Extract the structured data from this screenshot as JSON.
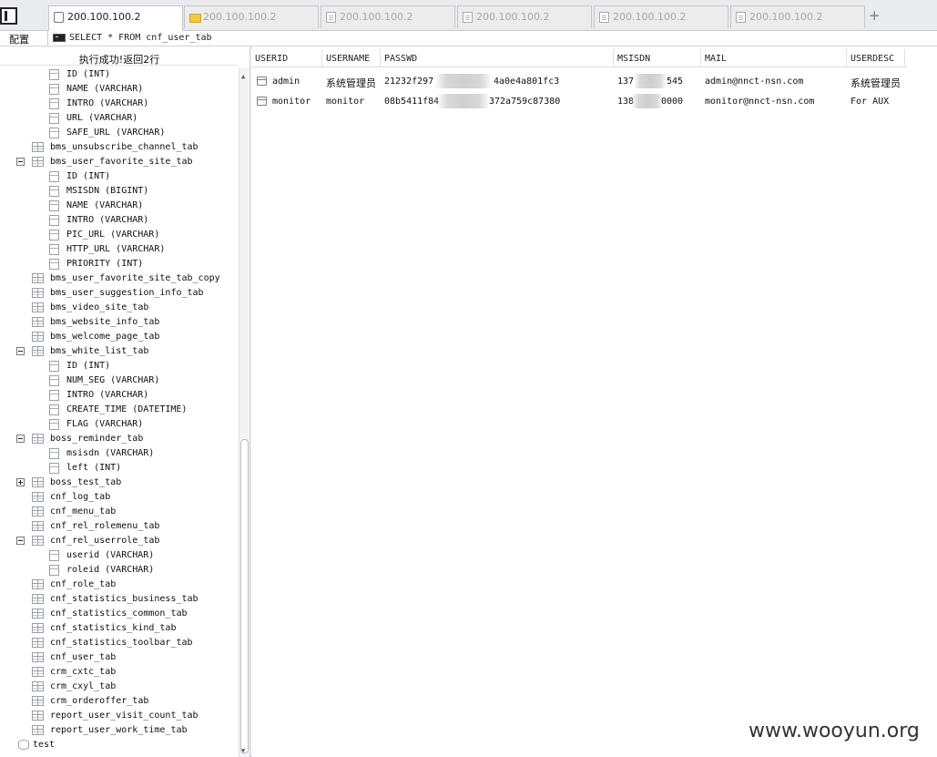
{
  "tabs": [
    {
      "label": "200.100.100.2",
      "icon": "blank-page-icon",
      "active": true
    },
    {
      "label": "200.100.100.2",
      "icon": "folder-icon",
      "active": false
    },
    {
      "label": "200.100.100.2",
      "icon": "document-icon",
      "active": false
    },
    {
      "label": "200.100.100.2",
      "icon": "document-icon",
      "active": false
    },
    {
      "label": "200.100.100.2",
      "icon": "document-icon",
      "active": false
    },
    {
      "label": "200.100.100.2",
      "icon": "document-icon",
      "active": false
    }
  ],
  "new_tab_symbol": "+",
  "toolbar": {
    "config_label": "配置",
    "query": "SELECT * FROM cnf_user_tab"
  },
  "left_panel": {
    "status": "执行成功!返回2行",
    "tree": [
      {
        "label": "ID (INT)",
        "kind": "column"
      },
      {
        "label": "NAME (VARCHAR)",
        "kind": "column"
      },
      {
        "label": "INTRO (VARCHAR)",
        "kind": "column"
      },
      {
        "label": "URL (VARCHAR)",
        "kind": "column"
      },
      {
        "label": "SAFE_URL (VARCHAR)",
        "kind": "column"
      },
      {
        "label": "bms_unsubscribe_channel_tab",
        "kind": "table"
      },
      {
        "label": "bms_user_favorite_site_tab",
        "kind": "table",
        "expand": "minus"
      },
      {
        "label": "ID (INT)",
        "kind": "column"
      },
      {
        "label": "MSISDN (BIGINT)",
        "kind": "column"
      },
      {
        "label": "NAME (VARCHAR)",
        "kind": "column"
      },
      {
        "label": "INTRO (VARCHAR)",
        "kind": "column"
      },
      {
        "label": "PIC_URL (VARCHAR)",
        "kind": "column"
      },
      {
        "label": "HTTP_URL (VARCHAR)",
        "kind": "column"
      },
      {
        "label": "PRIORITY (INT)",
        "kind": "column"
      },
      {
        "label": "bms_user_favorite_site_tab_copy",
        "kind": "table"
      },
      {
        "label": "bms_user_suggestion_info_tab",
        "kind": "table"
      },
      {
        "label": "bms_video_site_tab",
        "kind": "table"
      },
      {
        "label": "bms_website_info_tab",
        "kind": "table"
      },
      {
        "label": "bms_welcome_page_tab",
        "kind": "table"
      },
      {
        "label": "bms_white_list_tab",
        "kind": "table",
        "expand": "minus"
      },
      {
        "label": "ID (INT)",
        "kind": "column"
      },
      {
        "label": "NUM_SEG (VARCHAR)",
        "kind": "column"
      },
      {
        "label": "INTRO (VARCHAR)",
        "kind": "column"
      },
      {
        "label": "CREATE_TIME (DATETIME)",
        "kind": "column"
      },
      {
        "label": "FLAG (VARCHAR)",
        "kind": "column"
      },
      {
        "label": "boss_reminder_tab",
        "kind": "table",
        "expand": "minus"
      },
      {
        "label": "msisdn (VARCHAR)",
        "kind": "column"
      },
      {
        "label": "left (INT)",
        "kind": "column"
      },
      {
        "label": "boss_test_tab",
        "kind": "table",
        "expand": "plus"
      },
      {
        "label": "cnf_log_tab",
        "kind": "table"
      },
      {
        "label": "cnf_menu_tab",
        "kind": "table"
      },
      {
        "label": "cnf_rel_rolemenu_tab",
        "kind": "table"
      },
      {
        "label": "cnf_rel_userrole_tab",
        "kind": "table",
        "expand": "minus"
      },
      {
        "label": "userid (VARCHAR)",
        "kind": "column"
      },
      {
        "label": "roleid (VARCHAR)",
        "kind": "column"
      },
      {
        "label": "cnf_role_tab",
        "kind": "table"
      },
      {
        "label": "cnf_statistics_business_tab",
        "kind": "table"
      },
      {
        "label": "cnf_statistics_common_tab",
        "kind": "table"
      },
      {
        "label": "cnf_statistics_kind_tab",
        "kind": "table"
      },
      {
        "label": "cnf_statistics_toolbar_tab",
        "kind": "table"
      },
      {
        "label": "cnf_user_tab",
        "kind": "table"
      },
      {
        "label": "crm_cxtc_tab",
        "kind": "table"
      },
      {
        "label": "crm_cxyl_tab",
        "kind": "table"
      },
      {
        "label": "crm_orderoffer_tab",
        "kind": "table"
      },
      {
        "label": "report_user_visit_count_tab",
        "kind": "table"
      },
      {
        "label": "report_user_work_time_tab",
        "kind": "table"
      },
      {
        "label": "test",
        "kind": "database"
      }
    ]
  },
  "result": {
    "columns": [
      "USERID",
      "USERNAME",
      "PASSWD",
      "MSISDN",
      "MAIL",
      "USERDESC"
    ],
    "rows": [
      {
        "userid": "admin",
        "username": "系统管理员",
        "passwd_start": "21232f297",
        "passwd_end": "4a0e4a801fc3",
        "msisdn_start": "137",
        "msisdn_end": "545",
        "mail": "admin@nnct-nsn.com",
        "userdesc": "系统管理员"
      },
      {
        "userid": "monitor",
        "username": "monitor",
        "passwd_start": "08b5411f84",
        "passwd_end": "372a759c87380",
        "msisdn_start": "138",
        "msisdn_end": "0000",
        "mail": "monitor@nnct-nsn.com",
        "userdesc": "For AUX"
      }
    ]
  },
  "watermark": "www.wooyun.org"
}
